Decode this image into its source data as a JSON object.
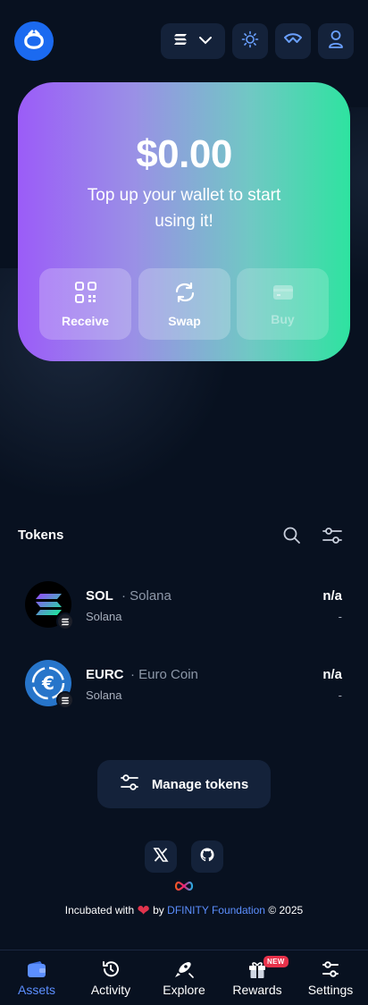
{
  "header": {
    "logo_icon": "oisy-logo-icon",
    "network_icon": "solana-icon",
    "theme_icon": "sun-icon",
    "walletconnect_icon": "walletconnect-icon",
    "user_icon": "user-icon"
  },
  "hero": {
    "balance": "$0.00",
    "message": "Top up your wallet to start using it!",
    "actions": [
      {
        "label": "Receive",
        "icon": "qr-code-icon"
      },
      {
        "label": "Swap",
        "icon": "swap-icon"
      },
      {
        "label": "Buy",
        "icon": "card-icon",
        "disabled": true
      }
    ]
  },
  "tokens": {
    "title": "Tokens",
    "items": [
      {
        "symbol": "SOL",
        "name": "· Solana",
        "network": "Solana",
        "balance": "n/a",
        "usd": "-"
      },
      {
        "symbol": "EURC",
        "name": "· Euro Coin",
        "network": "Solana",
        "balance": "n/a",
        "usd": "-"
      }
    ],
    "manage_label": "Manage tokens"
  },
  "footer": {
    "prefix": "Incubated with",
    "by": "by",
    "org": "DFINITY Foundation",
    "copyright": "© 2025"
  },
  "nav": {
    "items": [
      {
        "label": "Assets",
        "icon": "wallet-icon",
        "active": true
      },
      {
        "label": "Activity",
        "icon": "history-icon"
      },
      {
        "label": "Explore",
        "icon": "rocket-icon"
      },
      {
        "label": "Rewards",
        "icon": "gift-icon",
        "badge": "NEW"
      },
      {
        "label": "Settings",
        "icon": "settings-icon"
      }
    ]
  },
  "colors": {
    "background": "#081120",
    "accent": "#1b6af0",
    "link": "#5c8fff",
    "card_gradient_start": "#9b5cf8",
    "card_gradient_end": "#2ee3a0"
  }
}
